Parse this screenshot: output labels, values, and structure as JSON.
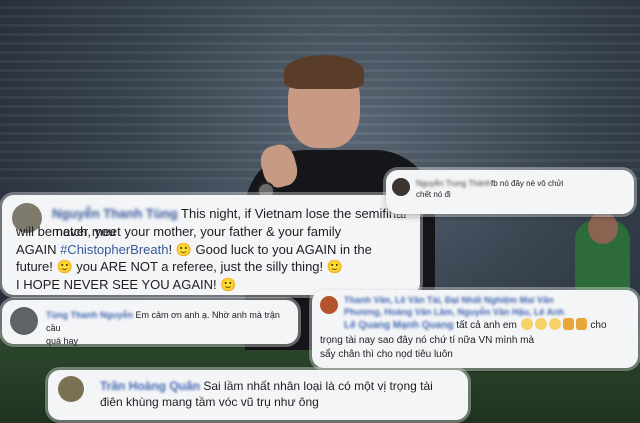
{
  "comments": {
    "c1": {
      "name": "Nguyễn Thanh Tùng",
      "line1": "This night, if Vietnam lose the semifinal match, you",
      "line2": "will be never meet your mother, your father & your family",
      "line3a": "AGAIN ",
      "hashtag": "#ChistopherBreath",
      "line3b": "! 🙂 Good luck to you AGAIN in the",
      "line4": "future! 🙂 you ARE NOT a referee, just the silly thing! 🙂",
      "line5": "I HOPE NEVER SEE YOU AGAIN! 🙂"
    },
    "c2": {
      "name": "Tùng Thanh Nguyễn",
      "text1": "Em cảm ơn anh ạ. Nhờ anh mà trận cầu",
      "text2": "quá hay"
    },
    "c3": {
      "name_blur": "Nguyễn Trung Thành",
      "text1": "fb nó đây nè vô chửi",
      "text2": "chết ",
      "text3": "nó đi"
    },
    "c4": {
      "names_line1": "Thanh Vân, Lê Văn Tài, Đại Nhất Nghiệm Mai Văn",
      "names_line2": "Phương, Hoàng Văn Lâm, Nguyễn Văn Hậu, Lê Anh",
      "names_line3": "Lê Quang Mạnh Quang",
      "tail1": " tất cả anh em ",
      "line2a": "trọng tài nay sao đây ",
      "line2b": " nó chứ tí nữa VN mình mà",
      "line2_suffix": "cho",
      "line3": "sẩy chân thì cho nọd tiêu luôn"
    },
    "c5": {
      "name": "Trần Hoàng Quân",
      "text1": "Sai lầm nhất nhân loại là có một vị trọng tài",
      "text2": "điên khùng mang tầm vóc vũ trụ như ông"
    }
  }
}
